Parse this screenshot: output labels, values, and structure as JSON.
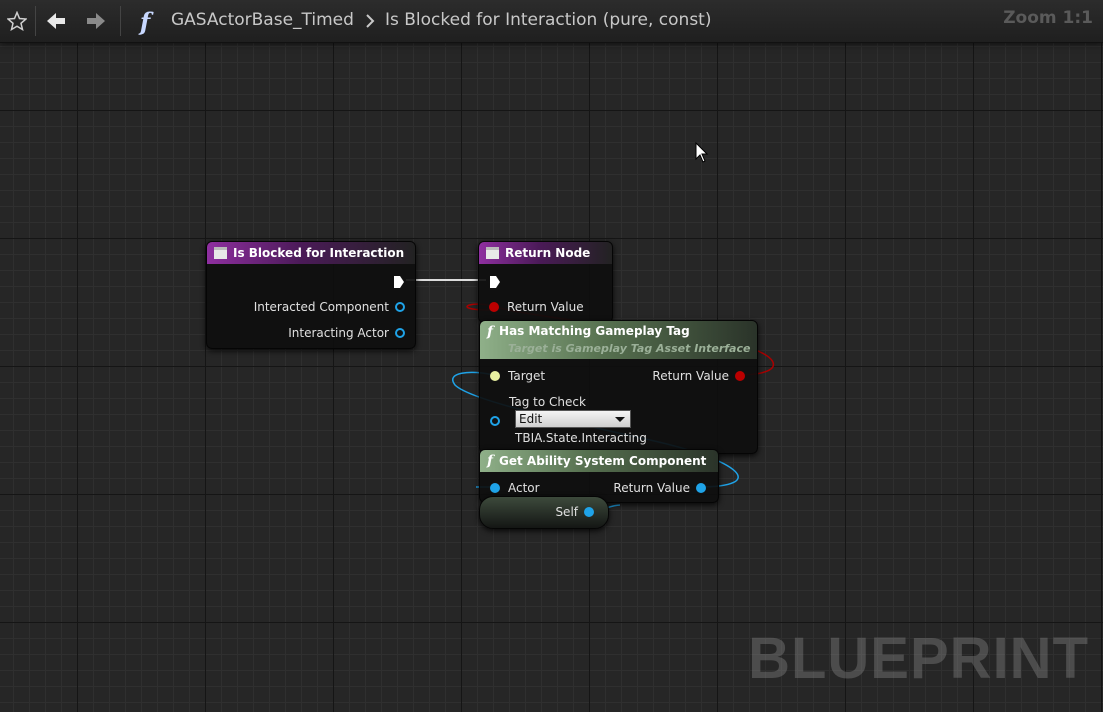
{
  "toolbar": {
    "star_icon": "star-icon",
    "back_icon": "arrow-left-icon",
    "forward_icon": "arrow-right-icon",
    "function_icon": "function-icon",
    "breadcrumb_blueprint": "GASActorBase_Timed",
    "breadcrumb_function": "Is Blocked for Interaction (pure, const)",
    "zoom": "Zoom 1:1"
  },
  "watermark": "BLUEPRINT",
  "nodes": {
    "entry": {
      "title": "Is Blocked for Interaction",
      "pins": [
        "Interacted Component",
        "Interacting Actor"
      ]
    },
    "return": {
      "title": "Return Node",
      "pins": [
        "Return Value"
      ]
    },
    "has_tag": {
      "title": "Has Matching Gameplay Tag",
      "subtitle": "Target is Gameplay Tag Asset Interface",
      "target": "Target",
      "return_value": "Return Value",
      "tag_label": "Tag to Check",
      "combo_value": "Edit",
      "tag_value": "TBIA.State.Interacting"
    },
    "get_asc": {
      "title": "Get Ability System Component",
      "actor": "Actor",
      "return_value": "Return Value"
    },
    "self": {
      "label": "Self"
    }
  },
  "colors": {
    "object_pin": "#1fa3e8",
    "bool_pin": "#b00000",
    "interface_pin": "#e8f0a0",
    "event_header": "#8f2fa0",
    "function_header": "#8fb089"
  }
}
